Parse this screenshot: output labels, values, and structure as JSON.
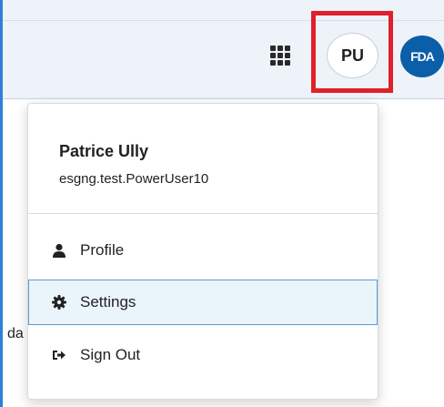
{
  "header": {
    "avatar_initials": "PU",
    "logo_text": "FDA"
  },
  "background": {
    "partial_text": "da"
  },
  "user_menu": {
    "name": "Patrice Ully",
    "username": "esgng.test.PowerUser10",
    "items": [
      {
        "label": "Profile",
        "icon": "user-icon"
      },
      {
        "label": "Settings",
        "icon": "gear-icon"
      },
      {
        "label": "Sign Out",
        "icon": "sign-out-icon"
      }
    ]
  },
  "colors": {
    "highlight": "#e0202a",
    "selected_bg": "#eaf4fb",
    "selected_border": "#5b9bd1",
    "logo_bg": "#0b5ea8"
  }
}
